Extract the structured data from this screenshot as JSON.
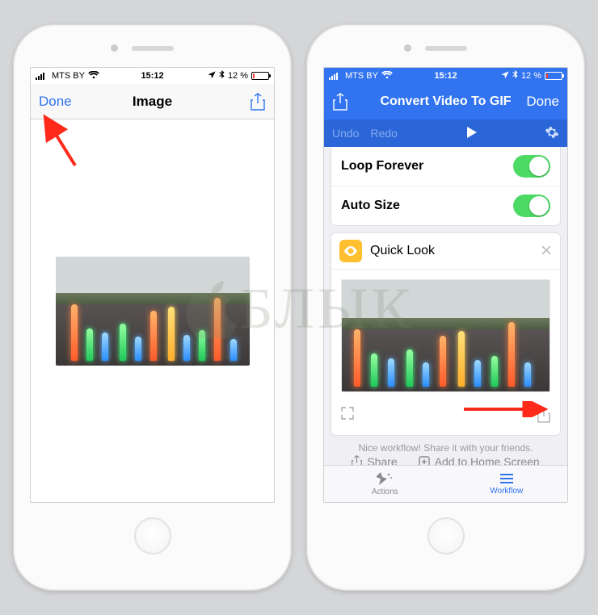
{
  "status": {
    "carrier": "MTS BY",
    "time": "15:12",
    "battery_text": "12 %"
  },
  "left": {
    "done": "Done",
    "title": "Image",
    "image_alt": "Colorful fountain jets at dusk"
  },
  "right": {
    "nav_title": "Convert Video To GIF",
    "done": "Done",
    "undo": "Undo",
    "redo": "Redo",
    "settings": {
      "loop_label": "Loop Forever",
      "autosize_label": "Auto Size"
    },
    "quicklook": {
      "title": "Quick Look",
      "image_alt": "Colorful fountain jets preview"
    },
    "share_hint": "Nice workflow! Share it with your friends.",
    "share": "Share",
    "add_home": "Add to Home Screen",
    "tab_actions": "Actions",
    "tab_workflow": "Workflow"
  },
  "watermark": "БЛЫК"
}
